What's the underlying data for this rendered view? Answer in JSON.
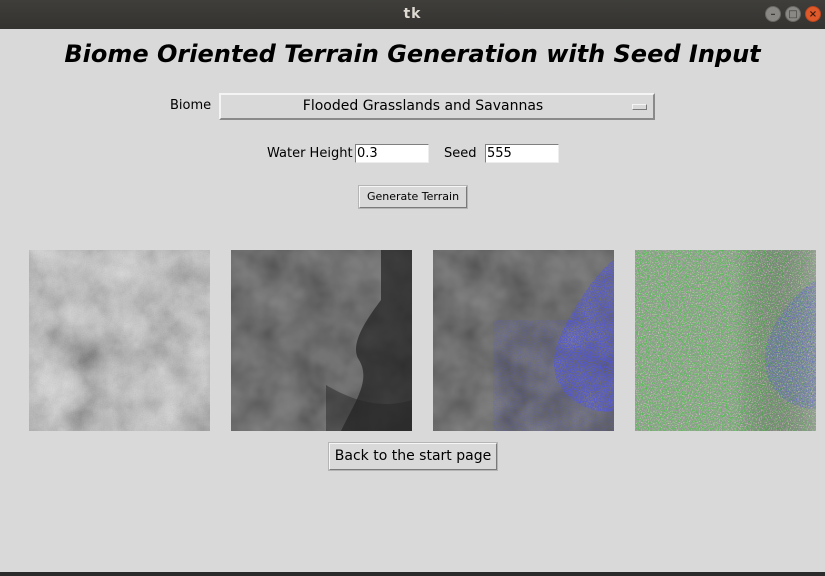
{
  "window": {
    "title": "tk",
    "minimize_glyph": "–",
    "maximize_glyph": "□",
    "close_glyph": "×"
  },
  "heading": "Biome Oriented Terrain Generation with Seed Input",
  "biome": {
    "label": "Biome",
    "selected": "Flooded Grasslands and Savannas"
  },
  "water_height": {
    "label": "Water Height",
    "value": "0.3"
  },
  "seed": {
    "label": "Seed",
    "value": "555"
  },
  "generate_button": "Generate Terrain",
  "back_button": "Back to the start page",
  "colors": {
    "background": "#d9d9d9",
    "water": "#1418c8",
    "grass": "#0c9a0c",
    "sand": "#d8d890",
    "rock": "#9a9a9a",
    "close": "#e0592a"
  },
  "images": [
    {
      "name": "heightmap-image",
      "icon": "grayscale-noise-map"
    },
    {
      "name": "dark-heightmap-image",
      "icon": "dark-noise-map"
    },
    {
      "name": "water-overlay-image",
      "icon": "dark-map-with-water"
    },
    {
      "name": "biome-color-image",
      "icon": "colored-biome-map"
    }
  ]
}
